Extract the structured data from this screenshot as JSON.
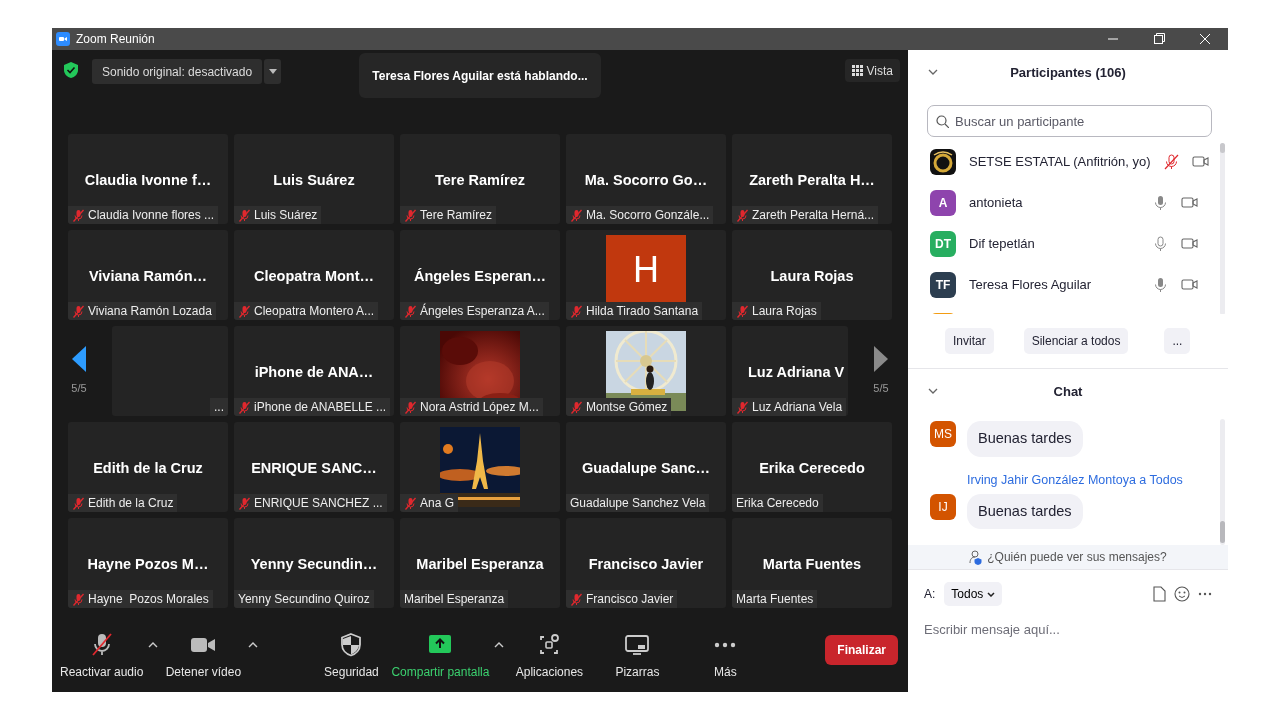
{
  "window": {
    "title": "Zoom Reunión"
  },
  "stage": {
    "original_sound": "Sonido original: desactivado",
    "speaking_toast": "Teresa Flores Aguilar está hablando...",
    "view_button": "Vista",
    "pager_left": {
      "label": "5/5",
      "disabled": false
    },
    "pager_right": {
      "label": "5/5",
      "disabled": true
    },
    "rows": [
      {
        "pager": false,
        "tiles": [
          {
            "kind": "name",
            "title": "Claudia Ivonne f…",
            "label": "Claudia Ivonne flores ...",
            "muted": true
          },
          {
            "kind": "name",
            "title": "Luis Suárez",
            "label": "Luis Suárez",
            "muted": true
          },
          {
            "kind": "name",
            "title": "Tere Ramírez",
            "label": "Tere Ramírez",
            "muted": true
          },
          {
            "kind": "name",
            "title": "Ma. Socorro Go…",
            "label": "Ma. Socorro Gonzále...",
            "muted": true
          },
          {
            "kind": "name",
            "title": "Zareth Peralta H…",
            "label": "Zareth Peralta Herná...",
            "muted": true
          }
        ]
      },
      {
        "pager": false,
        "tiles": [
          {
            "kind": "name",
            "title": "Viviana Ramón…",
            "label": "Viviana Ramón Lozada",
            "muted": true
          },
          {
            "kind": "name",
            "title": "Cleopatra Mont…",
            "label": "Cleopatra Montero A...",
            "muted": true
          },
          {
            "kind": "name",
            "title": "Ángeles Esperan…",
            "label": "Ángeles Esperanza A...",
            "muted": true
          },
          {
            "kind": "letter",
            "letter": "H",
            "color": "#c1380e",
            "label": "Hilda Tirado Santana",
            "muted": true
          },
          {
            "kind": "name",
            "title": "Laura Rojas",
            "label": "Laura Rojas",
            "muted": true
          }
        ]
      },
      {
        "pager": true,
        "tiles": [
          {
            "kind": "blank",
            "label": "...",
            "muted": false
          },
          {
            "kind": "name",
            "title": "iPhone de ANA…",
            "label": "iPhone de ANABELLE ...",
            "muted": true
          },
          {
            "kind": "picture",
            "label": "Nora Astrid López M...",
            "muted": true
          },
          {
            "kind": "picture",
            "label": "Montse Gómez",
            "muted": true
          },
          {
            "kind": "name",
            "title": "Luz Adriana V",
            "label": "Luz Adriana Vela",
            "muted": true
          }
        ]
      },
      {
        "pager": false,
        "tiles": [
          {
            "kind": "name",
            "title": "Edith de la Cruz",
            "label": "Edith de la Cruz",
            "muted": true
          },
          {
            "kind": "name",
            "title": "ENRIQUE SANC…",
            "label": "ENRIQUE SANCHEZ ...",
            "muted": true
          },
          {
            "kind": "picture",
            "label": "Ana G",
            "muted": true
          },
          {
            "kind": "name",
            "title": "Guadalupe Sanc…",
            "label": "Guadalupe Sanchez Vela",
            "muted": false
          },
          {
            "kind": "name",
            "title": "Erika Cerecedo",
            "label": "Erika Cerecedo",
            "muted": false
          }
        ]
      },
      {
        "pager": false,
        "tiles": [
          {
            "kind": "name",
            "title": "Hayne Pozos M…",
            "label": "Hayne  Pozos Morales",
            "muted": true
          },
          {
            "kind": "name",
            "title": "Yenny Secundin…",
            "label": "Yenny Secundino Quiroz",
            "muted": false
          },
          {
            "kind": "name",
            "title": "Maribel Esperanza",
            "label": "Maribel Esperanza",
            "muted": false
          },
          {
            "kind": "name",
            "title": "Francisco Javier",
            "label": "Francisco Javier",
            "muted": true
          },
          {
            "kind": "name",
            "title": "Marta Fuentes",
            "label": "Marta Fuentes",
            "muted": false
          }
        ]
      }
    ]
  },
  "toolbar": {
    "items": [
      {
        "kind": "mic",
        "label": "Reactivar audio",
        "caret": true,
        "active": false
      },
      {
        "kind": "video",
        "label": "Detener vídeo",
        "caret": true,
        "active": false
      },
      {
        "kind": "security",
        "label": "Seguridad",
        "caret": false,
        "active": false
      },
      {
        "kind": "share",
        "label": "Compartir pantalla",
        "caret": true,
        "active": true
      },
      {
        "kind": "apps",
        "label": "Aplicaciones",
        "caret": false,
        "active": false
      },
      {
        "kind": "whiteboard",
        "label": "Pizarras",
        "caret": false,
        "active": false
      },
      {
        "kind": "more",
        "label": "Más",
        "caret": false,
        "active": false
      }
    ],
    "end_button": "Finalizar"
  },
  "participants": {
    "title": "Participantes (106)",
    "search_placeholder": "Buscar un participante",
    "items": [
      {
        "kind": "logo",
        "name": "SETSE ESTATAL (Anfitrión, yo)",
        "muted": true
      },
      {
        "kind": "initials",
        "initials": "A",
        "color": "#8e44ad",
        "name": "antonieta",
        "muted": false,
        "speaking": true
      },
      {
        "kind": "initials",
        "initials": "DT",
        "color": "#27ae60",
        "name": "Dif tepetlán",
        "muted": false,
        "speaking": false
      },
      {
        "kind": "initials",
        "initials": "TF",
        "color": "#2c3e50",
        "name": "Teresa Flores Aguilar",
        "muted": false,
        "speaking": true
      },
      {
        "kind": "initials",
        "color": "#f39c12"
      }
    ],
    "buttons": [
      "Invitar",
      "Silenciar a todos",
      "..."
    ]
  },
  "chat": {
    "title": "Chat",
    "messages": [
      {
        "initials": "MS",
        "color": "#d35400",
        "text": "Buenas tardes"
      },
      {
        "sender": "Irving Jahir González Montoya a Todos",
        "initials": "IJ",
        "color": "#d35400",
        "text": "Buenas tardes"
      }
    ],
    "privacy_note": "¿Quién puede ver sus mensajes?",
    "to_label": "A:",
    "recipient": "Todos",
    "placeholder": "Escribir mensaje aquí..."
  }
}
